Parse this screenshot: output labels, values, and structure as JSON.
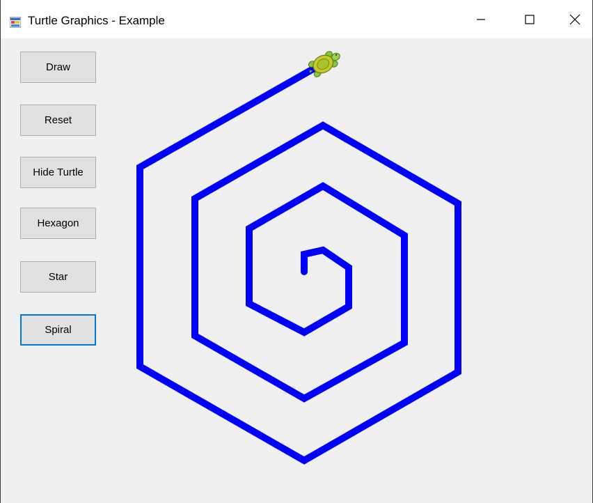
{
  "window": {
    "title": "Turtle Graphics - Example",
    "controls": {
      "minimize": "minimize",
      "maximize": "maximize",
      "close": "close"
    }
  },
  "buttons": [
    {
      "label": "Draw"
    },
    {
      "label": "Reset"
    },
    {
      "label": "Hide Turtle"
    },
    {
      "label": "Hexagon"
    },
    {
      "label": "Star"
    },
    {
      "label": "Spiral"
    }
  ],
  "focused_button": "Spiral",
  "drawing": {
    "shape": "spiral",
    "pen_color": "#0000ff",
    "turtle_visible": true
  },
  "colors": {
    "background": "#f0f0f0",
    "titlebar": "#ffffff",
    "button_face": "#e1e1e1",
    "focus_border": "#0078d7",
    "pen": "#0000ff"
  }
}
